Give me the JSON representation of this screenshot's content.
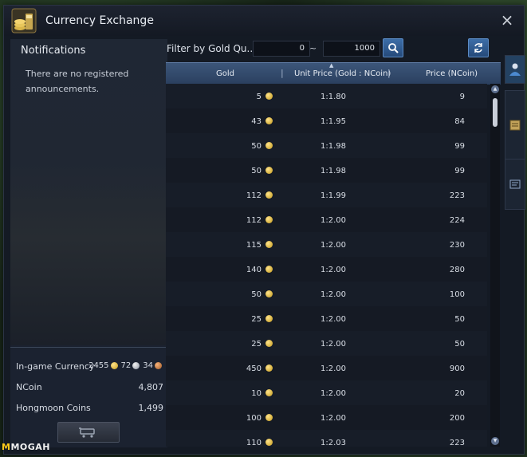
{
  "window": {
    "title": "Currency Exchange"
  },
  "notifications": {
    "title": "Notifications",
    "message": "There are no registered announcements."
  },
  "currency": {
    "ingame_label": "In-game Currency",
    "gold": "2455",
    "silver": "72",
    "copper": "34",
    "ncoin_label": "NCoin",
    "ncoin_value": "4,807",
    "hongmoon_label": "Hongmoon Coins",
    "hongmoon_value": "1,499"
  },
  "filter": {
    "label": "Filter by Gold Qu...",
    "min": "0",
    "tilde": "~",
    "max": "1000"
  },
  "table": {
    "headers": {
      "gold": "Gold",
      "unit_price": "Unit Price (Gold : NCoin)",
      "price": "Price (NCoin)"
    },
    "rows": [
      {
        "gold": "5",
        "unit": "1:1.80",
        "price": "9"
      },
      {
        "gold": "43",
        "unit": "1:1.95",
        "price": "84"
      },
      {
        "gold": "50",
        "unit": "1:1.98",
        "price": "99"
      },
      {
        "gold": "50",
        "unit": "1:1.98",
        "price": "99"
      },
      {
        "gold": "112",
        "unit": "1:1.99",
        "price": "223"
      },
      {
        "gold": "112",
        "unit": "1:2.00",
        "price": "224"
      },
      {
        "gold": "115",
        "unit": "1:2.00",
        "price": "230"
      },
      {
        "gold": "140",
        "unit": "1:2.00",
        "price": "280"
      },
      {
        "gold": "50",
        "unit": "1:2.00",
        "price": "100"
      },
      {
        "gold": "25",
        "unit": "1:2.00",
        "price": "50"
      },
      {
        "gold": "25",
        "unit": "1:2.00",
        "price": "50"
      },
      {
        "gold": "450",
        "unit": "1:2.00",
        "price": "900"
      },
      {
        "gold": "10",
        "unit": "1:2.00",
        "price": "20"
      },
      {
        "gold": "100",
        "unit": "1:2.00",
        "price": "200"
      },
      {
        "gold": "110",
        "unit": "1:2.03",
        "price": "223"
      }
    ]
  },
  "watermark": {
    "brand_m": "M",
    "brand_rest": "MOGAH"
  },
  "colors": {
    "header_blue": "#34507a",
    "button_blue": "#3d6ea8",
    "gold_coin": "#e1b63a"
  },
  "icons": [
    "currency-exchange-icon",
    "close-icon",
    "search-icon",
    "refresh-icon",
    "exchange-cart-icon",
    "gold-coin-icon",
    "silver-coin-icon",
    "copper-coin-icon",
    "scroll-up-icon",
    "scroll-down-icon",
    "character-icon",
    "ledger-icon",
    "history-icon"
  ]
}
